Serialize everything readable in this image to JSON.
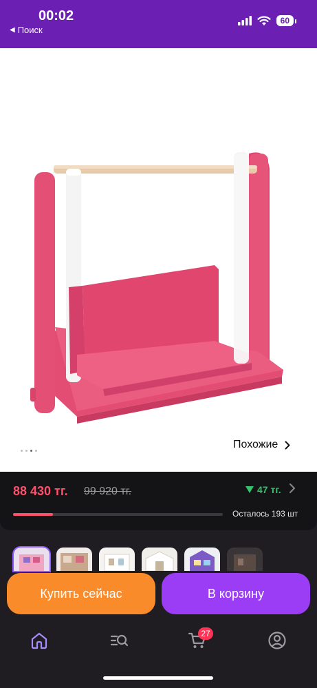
{
  "status_bar": {
    "time": "00:02",
    "back_app": "Поиск",
    "battery": "60"
  },
  "header": {
    "back_icon": "chevron-left-icon",
    "favorite_icon": "heart-icon",
    "share_icon": "share-icon"
  },
  "gallery": {
    "similar_label": "Похожие",
    "dot_count": 4,
    "active_dot": 2
  },
  "price": {
    "current": "88 430 тг.",
    "old": "99 920 тг.",
    "cashback": "47 тг.",
    "stock_progress": 0.19,
    "remaining": "Осталось 193 шт"
  },
  "actions": {
    "buy_now": "Купить сейчас",
    "add_to_cart": "В корзину"
  },
  "tab_bar": {
    "cart_badge": "27"
  },
  "colors": {
    "brand_purple": "#6b1fb3",
    "price_red": "#ff4f6b",
    "buy_orange": "#f98b2a",
    "cart_purple": "#9b3df4",
    "cashback_green": "#35c26b"
  }
}
